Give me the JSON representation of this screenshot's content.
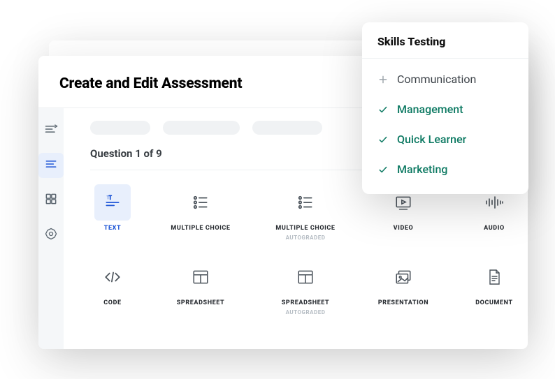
{
  "header": {
    "title": "Create and Edit Assessment"
  },
  "sidebar": {
    "items": [
      {
        "name": "steps"
      },
      {
        "name": "questions"
      },
      {
        "name": "grid"
      },
      {
        "name": "settings"
      }
    ],
    "active_index": 1
  },
  "main": {
    "question_label": "Question 1 of 9",
    "type_row_1": [
      {
        "key": "text",
        "label": "TEXT",
        "sublabel": "",
        "selected": true
      },
      {
        "key": "multiple-choice",
        "label": "MULTIPLE CHOICE",
        "sublabel": "",
        "selected": false
      },
      {
        "key": "multiple-choice-auto",
        "label": "MULTIPLE CHOICE",
        "sublabel": "AUTOGRADED",
        "selected": false
      },
      {
        "key": "video",
        "label": "VIDEO",
        "sublabel": "",
        "selected": false
      },
      {
        "key": "audio",
        "label": "AUDIO",
        "sublabel": "",
        "selected": false
      }
    ],
    "type_row_2": [
      {
        "key": "code",
        "label": "CODE",
        "sublabel": "",
        "selected": false
      },
      {
        "key": "spreadsheet",
        "label": "SPREADSHEET",
        "sublabel": "",
        "selected": false
      },
      {
        "key": "spreadsheet-auto",
        "label": "SPREADSHEET",
        "sublabel": "AUTOGRADED",
        "selected": false
      },
      {
        "key": "presentation",
        "label": "PRESENTATION",
        "sublabel": "",
        "selected": false
      },
      {
        "key": "document",
        "label": "DOCUMENT",
        "sublabel": "",
        "selected": false
      }
    ]
  },
  "popover": {
    "title": "Skills Testing",
    "skills": [
      {
        "label": "Communication",
        "checked": false
      },
      {
        "label": "Management",
        "checked": true
      },
      {
        "label": "Quick Learner",
        "checked": true
      },
      {
        "label": "Marketing",
        "checked": true
      }
    ]
  }
}
